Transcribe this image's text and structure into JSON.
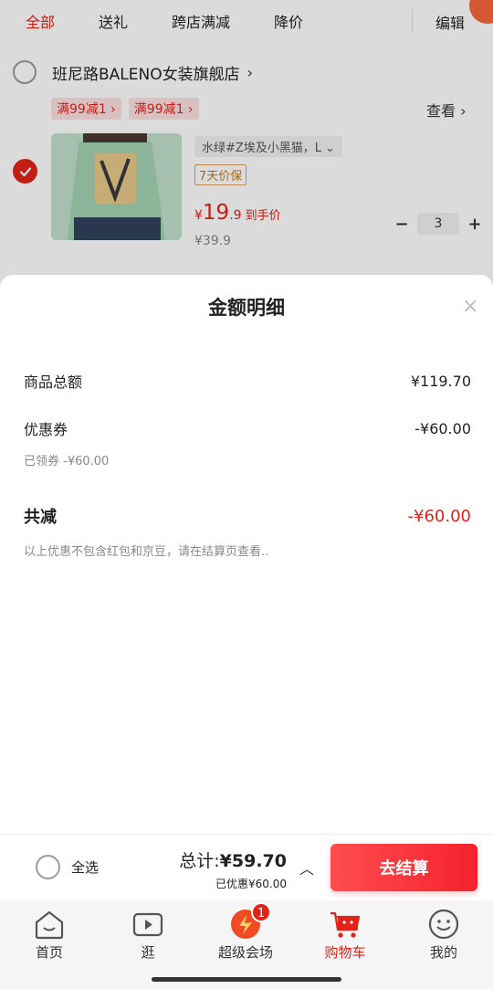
{
  "top_tabs": [
    "全部",
    "送礼",
    "跨店满减",
    "降价"
  ],
  "top_edit": "编辑",
  "shop": {
    "name": "班尼路BALENO女装旗舰店",
    "arrow": "›"
  },
  "coupons": [
    "满99减1 ›",
    "满99减1 ›"
  ],
  "view_link": "查看 ›",
  "item": {
    "sku": "水绿#Z埃及小黑猫，L  ⌄",
    "warranty": "7天价保",
    "price_symbol": "¥",
    "price_main": "19",
    "price_decimal": ".9",
    "price_tail": "到手价",
    "original_price": "¥39.9",
    "quantity": "3",
    "minus": "−",
    "plus": "+"
  },
  "sheet": {
    "title": "金额明细",
    "close": "×",
    "goods_total_label": "商品总额",
    "goods_total_value": "¥119.70",
    "coupon_label": "优惠券",
    "coupon_value": "-¥60.00",
    "coupon_note": "已领券 -¥60.00",
    "total_reduce_label": "共减",
    "total_reduce_value": "-¥60.00",
    "disclaimer": "以上优惠不包含红包和京豆，请在结算页查看.."
  },
  "bottom_bar": {
    "select_all": "全选",
    "total_prefix": "总计:",
    "total_value": "¥59.70",
    "saved": "已优惠¥60.00",
    "expand": "︿",
    "checkout": "去结算"
  },
  "tabbar": {
    "items": [
      {
        "label": "首页",
        "icon": "home-icon"
      },
      {
        "label": "逛",
        "icon": "play-icon"
      },
      {
        "label": "超级会场",
        "icon": "super-venue-icon",
        "badge": "1"
      },
      {
        "label": "购物车",
        "icon": "cart-icon"
      },
      {
        "label": "我的",
        "icon": "smile-face-icon"
      }
    ]
  },
  "colors": {
    "accent": "#e2231a",
    "checkout_start": "#ff4d4f",
    "checkout_end": "#f5222d"
  }
}
